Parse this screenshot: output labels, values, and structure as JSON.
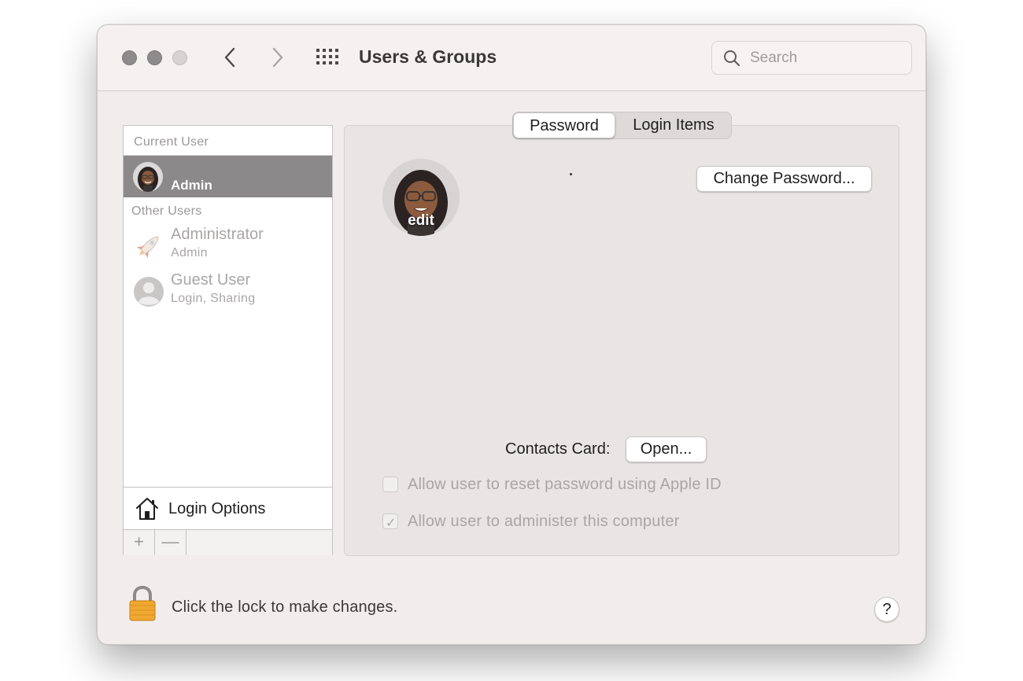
{
  "window": {
    "title": "Users & Groups",
    "search_placeholder": "Search"
  },
  "sidebar": {
    "current_user_label": "Current User",
    "current_user": {
      "name": "Admin"
    },
    "other_users_label": "Other Users",
    "other_users": [
      {
        "name": "Administrator",
        "subtitle": "Admin",
        "icon": "rocket-avatar-icon"
      },
      {
        "name": "Guest User",
        "subtitle": "Login, Sharing",
        "icon": "person-silhouette-icon"
      }
    ],
    "login_options_label": "Login Options",
    "add_label": "+",
    "remove_label": "—"
  },
  "tabs": [
    {
      "label": "Password",
      "selected": true
    },
    {
      "label": "Login Items",
      "selected": false
    }
  ],
  "panel": {
    "avatar_edit_label": "edit",
    "change_password_label": "Change Password...",
    "contacts_card_label": "Contacts Card:",
    "open_label": "Open...",
    "checkboxes": [
      {
        "label": "Allow user to reset password using Apple ID",
        "checked": false
      },
      {
        "label": "Allow user to administer this computer",
        "checked": true
      }
    ]
  },
  "footer": {
    "lock_text": "Click the lock to make changes.",
    "help_label": "?"
  },
  "colors": {
    "selection": "#8b898a",
    "window_bg": "#f2eded"
  }
}
